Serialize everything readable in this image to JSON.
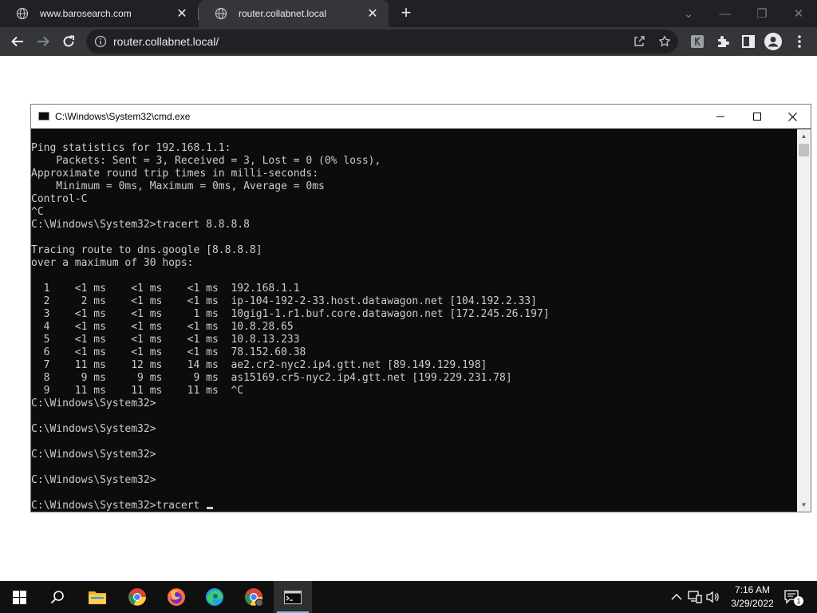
{
  "browser": {
    "tabs": [
      {
        "label": "www.barosearch.com",
        "active": false
      },
      {
        "label": "router.collabnet.local",
        "active": true
      }
    ],
    "url": "router.collabnet.local/"
  },
  "cmd_window": {
    "title": "C:\\Windows\\System32\\cmd.exe",
    "lines": [
      "Ping statistics for 192.168.1.1:",
      "    Packets: Sent = 3, Received = 3, Lost = 0 (0% loss),",
      "Approximate round trip times in milli-seconds:",
      "    Minimum = 0ms, Maximum = 0ms, Average = 0ms",
      "Control-C",
      "^C",
      "C:\\Windows\\System32>tracert 8.8.8.8",
      "",
      "Tracing route to dns.google [8.8.8.8]",
      "over a maximum of 30 hops:",
      "",
      "  1    <1 ms    <1 ms    <1 ms  192.168.1.1",
      "  2     2 ms    <1 ms    <1 ms  ip-104-192-2-33.host.datawagon.net [104.192.2.33]",
      "  3    <1 ms    <1 ms     1 ms  10gig1-1.r1.buf.core.datawagon.net [172.245.26.197]",
      "  4    <1 ms    <1 ms    <1 ms  10.8.28.65",
      "  5    <1 ms    <1 ms    <1 ms  10.8.13.233",
      "  6    <1 ms    <1 ms    <1 ms  78.152.60.38",
      "  7    11 ms    12 ms    14 ms  ae2.cr2-nyc2.ip4.gtt.net [89.149.129.198]",
      "  8     9 ms     9 ms     9 ms  as15169.cr5-nyc2.ip4.gtt.net [199.229.231.78]",
      "  9    11 ms    11 ms    11 ms  ^C",
      "C:\\Windows\\System32>",
      "",
      "C:\\Windows\\System32>",
      "",
      "C:\\Windows\\System32>",
      "",
      "C:\\Windows\\System32>",
      "",
      "C:\\Windows\\System32>tracert "
    ]
  },
  "taskbar": {
    "time": "7:16 AM",
    "date": "3/29/2022",
    "notification_count": "1"
  },
  "colors": {
    "chrome_dark": "#202124",
    "chrome_toolbar": "#35363a",
    "console_bg": "#0c0c0c",
    "console_text": "#cccccc",
    "taskbar_bg": "#101010",
    "taskbar_accent": "#76b9ed"
  },
  "icons": [
    "globe-icon",
    "close-icon",
    "plus-icon",
    "back-arrow-icon",
    "forward-arrow-icon",
    "reload-icon",
    "info-icon",
    "share-icon",
    "star-icon",
    "extension-icon",
    "puzzle-icon",
    "side-panel-icon",
    "profile-icon",
    "menu-icon",
    "windows-start-icon",
    "search-icon",
    "file-explorer-icon",
    "chrome-icon",
    "firefox-icon",
    "edge-icon",
    "terminal-icon",
    "chevron-up-icon",
    "network-icon",
    "volume-icon",
    "notification-icon"
  ]
}
